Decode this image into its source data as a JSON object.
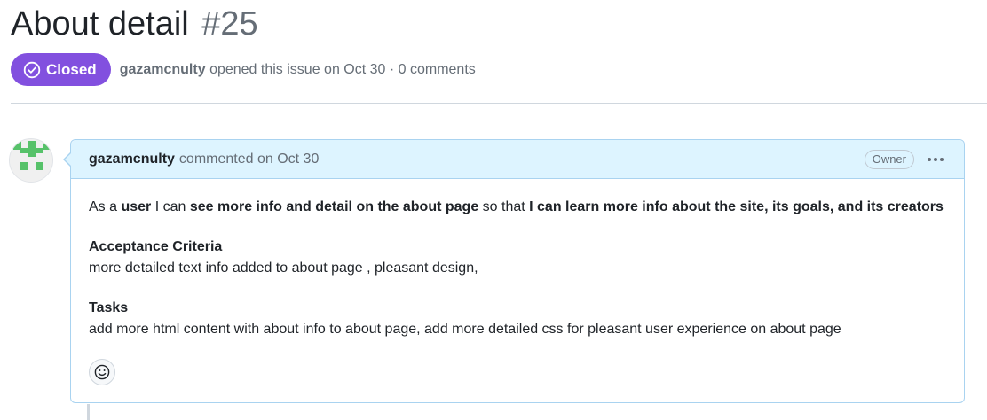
{
  "issue": {
    "title": "About detail",
    "number": "#25",
    "state": "Closed",
    "author": "gazamcnulty",
    "opened_text": "opened this issue on Oct 30 · 0 comments"
  },
  "comment": {
    "author": "gazamcnulty",
    "action": "commented on Oct 30",
    "badge": "Owner",
    "story": {
      "t1": "As a ",
      "b1": "user",
      "t2": " I can ",
      "b2": "see more info and detail on the about page",
      "t3": " so that ",
      "b3": "I can learn more info about the site, its goals, and its creators"
    },
    "sections": [
      {
        "heading": "Acceptance Criteria",
        "text": "more detailed text info added to about page , pleasant design,"
      },
      {
        "heading": "Tasks",
        "text": "add more html content with about info to about page, add more detailed css for pleasant user experience on about page"
      }
    ]
  },
  "icons": {
    "state": "check-circle-icon",
    "more": "kebab-horizontal-icon",
    "reaction": "smiley-icon",
    "avatar": "identicon"
  },
  "colors": {
    "closed_badge": "#8250df",
    "comment_header_bg": "#ddf4ff",
    "comment_border": "#a9d3f0",
    "identicon": "#57c26a"
  }
}
